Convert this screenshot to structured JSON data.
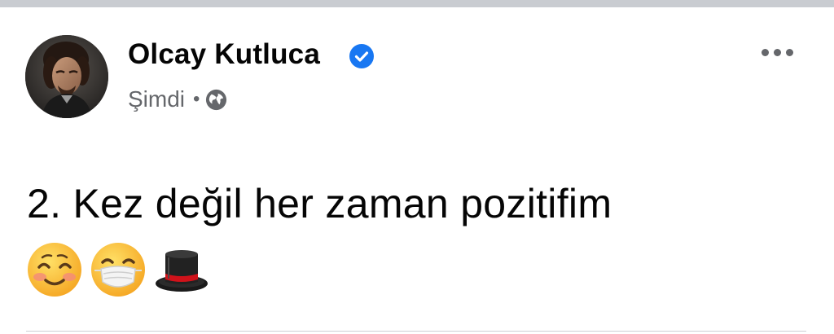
{
  "post": {
    "author_name": "Olcay Kutluca",
    "timestamp": "Şimdi",
    "separator": "•",
    "privacy_icon": "globe-icon",
    "verified_icon": "verified-badge-icon",
    "more_icon": "more-horizontal-icon",
    "text": "2. Kez değil her zaman pozitifim",
    "emojis": [
      "smiling-face-with-smiling-eyes",
      "face-with-medical-mask",
      "top-hat"
    ]
  },
  "colors": {
    "name_text": "#050505",
    "meta_text": "#65676b",
    "verified_blue": "#1877f2",
    "top_strip": "#c9ccd1",
    "divider": "#ced0d4"
  }
}
